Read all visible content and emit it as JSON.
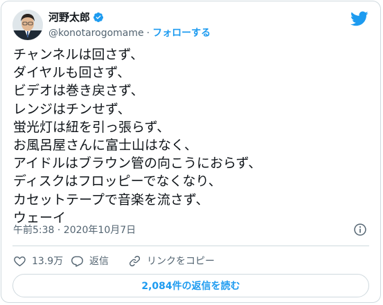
{
  "user": {
    "display_name": "河野太郎",
    "handle": "@konotarogomame",
    "separator": "·",
    "follow_label": "フォローする",
    "verified": true
  },
  "tweet": {
    "lines": [
      "チャンネルは回さず、",
      "ダイヤルも回さず、",
      "ビデオは巻き戻さず、",
      "レンジはチンせず、",
      "蛍光灯は紐を引っ張らず、",
      "お風呂屋さんに富士山はなく、",
      "アイドルはブラウン管の向こうにおらず、",
      "ディスクはフロッピーでなくなり、",
      "カセットテープで音楽を流さず、",
      "ウェーイ"
    ],
    "timestamp": "午前5:38 · 2020年10月7日"
  },
  "actions": {
    "like_count": "13.9万",
    "reply_label": "返信",
    "copy_link_label": "リンクをコピー"
  },
  "replies_button_label": "2,084件の返信を読む",
  "colors": {
    "accent": "#1d9bf0",
    "text": "#0f1419",
    "secondary": "#536471",
    "border": "#cfd9de"
  },
  "icons": [
    "twitter-bird-icon",
    "verified-badge-icon",
    "info-icon",
    "heart-icon",
    "reply-icon",
    "link-icon"
  ]
}
